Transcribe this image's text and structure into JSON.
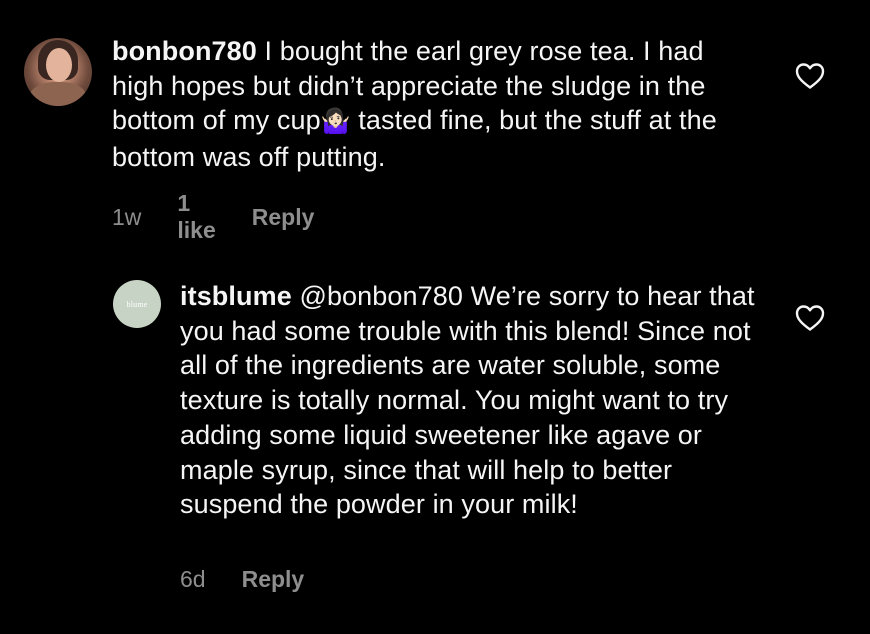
{
  "comments": [
    {
      "username": "bonbon780",
      "mention": "",
      "text_parts": [
        " I bought the earl grey rose tea. I had high hopes but didn’t appreciate the sludge in the bottom of my cup",
        "🤷🏻‍♀️",
        " tasted fine, but the stuff at the bottom was off putting."
      ],
      "time": "1w",
      "likes": "1 like",
      "reply_label": "Reply",
      "like_icon": "heart-outline-icon"
    },
    {
      "username": "itsblume",
      "avatar_text": "blume",
      "mention": "@bonbon780",
      "text": " We’re sorry to hear that you had some trouble with this blend! Since not all of the ingredients are water soluble, some texture is totally normal. You might want to try adding some liquid sweetener like agave or maple syrup, since that will help to better suspend the powder in your milk!",
      "time": "6d",
      "reply_label": "Reply",
      "like_icon": "heart-outline-icon"
    }
  ],
  "colors": {
    "background": "#000000",
    "text": "#f5f5f5",
    "muted": "#8e8e8e",
    "brand_avatar": "#c7d3c5"
  }
}
